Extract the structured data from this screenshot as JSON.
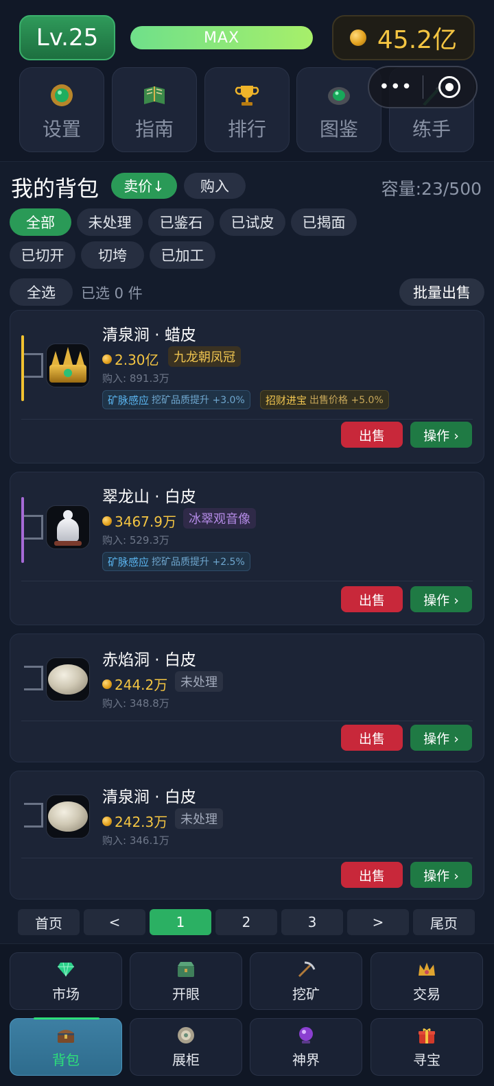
{
  "header": {
    "level": "Lv.25",
    "xp_label": "MAX",
    "gold": "45.2亿",
    "nav": [
      {
        "label": "设置",
        "icon": "emerald-ornament-icon"
      },
      {
        "label": "指南",
        "icon": "book-icon"
      },
      {
        "label": "排行",
        "icon": "trophy-icon"
      },
      {
        "label": "图鉴",
        "icon": "gem-stone-icon"
      },
      {
        "label": "练手",
        "icon": "knife-icon"
      }
    ]
  },
  "backpack": {
    "title": "我的背包",
    "sort_active": "卖价↓",
    "sort_other": "购入",
    "capacity": "容量:23/500",
    "filters": [
      "全部",
      "未处理",
      "已鉴石",
      "已试皮",
      "已揭面",
      "已切开",
      "切垮",
      "已加工"
    ],
    "select_all": "全选",
    "selected_text": "已选 0 件",
    "bulk_sell": "批量出售"
  },
  "items": [
    {
      "name": "清泉涧 · 蜡皮",
      "price": "2.30亿",
      "tag": "九龙朝凤冠",
      "buy_price": "购入: 891.3万",
      "rarity_color": "#f2c230",
      "buffs": [
        {
          "name": "矿脉感应",
          "desc": "挖矿品质提升 +3.0%"
        },
        {
          "name": "招财进宝",
          "desc": "出售价格 +5.0%"
        }
      ]
    },
    {
      "name": "翠龙山 · 白皮",
      "price": "3467.9万",
      "tag": "冰翠观音像",
      "buy_price": "购入: 529.3万",
      "rarity_color": "#a66ad6",
      "buffs": [
        {
          "name": "矿脉感应",
          "desc": "挖矿品质提升 +2.5%"
        }
      ]
    },
    {
      "name": "赤焰洞 · 白皮",
      "price": "244.2万",
      "tag": "未处理",
      "buy_price": "购入: 348.8万"
    },
    {
      "name": "清泉涧 · 白皮",
      "price": "242.3万",
      "tag": "未处理",
      "buy_price": "购入: 346.1万"
    }
  ],
  "item_actions": {
    "sell": "出售",
    "operate": "操作 ›"
  },
  "pagination": [
    "首页",
    "<",
    "1",
    "2",
    "3",
    ">",
    "尾页"
  ],
  "current_page": "1",
  "bottom_nav": [
    {
      "label": "市场",
      "icon": "diamond-icon"
    },
    {
      "label": "开眼",
      "icon": "jade-box-icon"
    },
    {
      "label": "挖矿",
      "icon": "pickaxe-icon"
    },
    {
      "label": "交易",
      "icon": "crown-icon"
    },
    {
      "label": "背包",
      "icon": "treasure-chest-icon"
    },
    {
      "label": "展柜",
      "icon": "display-orb-icon"
    },
    {
      "label": "神界",
      "icon": "purple-orb-icon"
    },
    {
      "label": "寻宝",
      "icon": "gift-box-icon"
    }
  ],
  "bottom_nav_active": "背包"
}
